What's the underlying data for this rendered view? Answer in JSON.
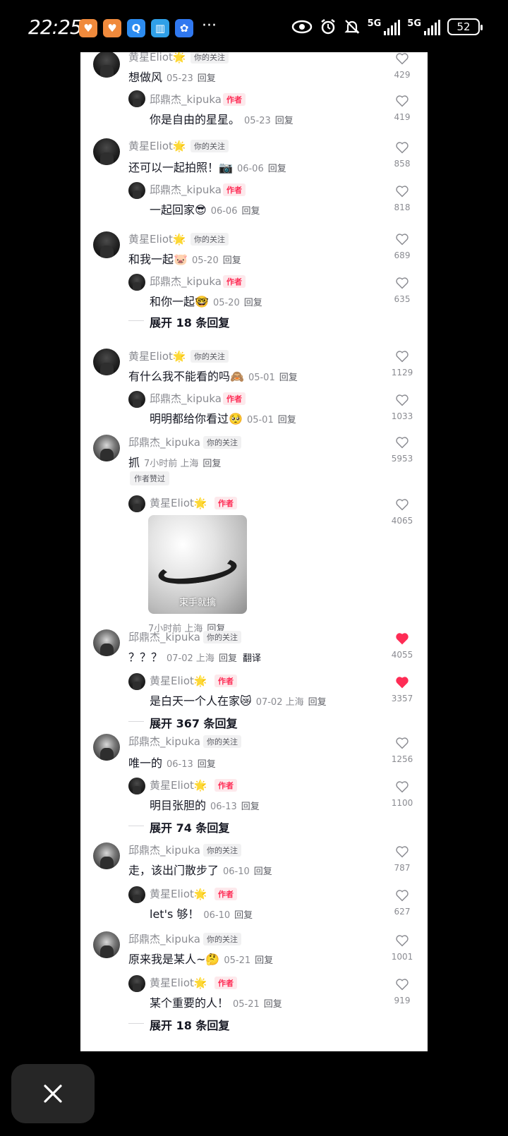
{
  "status_bar": {
    "time": "22:25",
    "network_1": "5G",
    "network_2": "5G",
    "battery": "52"
  },
  "comments": [
    {
      "user": "黄星Eliot🌟",
      "tag": "你的关注",
      "text": "想做风",
      "date": "05-23",
      "reply": "回复",
      "likes": "429",
      "sub": {
        "user": "邱鼎杰_kipuka",
        "tag": "作者",
        "text": "你是自由的星星。",
        "date": "05-23",
        "reply": "回复",
        "likes": "419"
      }
    },
    {
      "user": "黄星Eliot🌟",
      "tag": "你的关注",
      "text": "还可以一起拍照！📷",
      "date": "06-06",
      "reply": "回复",
      "likes": "858",
      "sub": {
        "user": "邱鼎杰_kipuka",
        "tag": "作者",
        "text": "一起回家😎",
        "date": "06-06",
        "reply": "回复",
        "likes": "818"
      }
    },
    {
      "user": "黄星Eliot🌟",
      "tag": "你的关注",
      "text": "和我一起🐷",
      "date": "05-20",
      "reply": "回复",
      "likes": "689",
      "sub": {
        "user": "邱鼎杰_kipuka",
        "tag": "作者",
        "text": "和你一起🤓",
        "date": "05-20",
        "reply": "回复",
        "likes": "635"
      },
      "expand": "展开 18 条回复"
    },
    {
      "user": "黄星Eliot🌟",
      "tag": "你的关注",
      "text": "有什么我不能看的吗🙈",
      "date": "05-01",
      "reply": "回复",
      "likes": "1129",
      "sub": {
        "user": "邱鼎杰_kipuka",
        "tag": "作者",
        "text": "明明都给你看过🥺",
        "date": "05-01",
        "reply": "回复",
        "likes": "1033"
      }
    },
    {
      "user": "邱鼎杰_kipuka",
      "tag": "你的关注",
      "text": "抓",
      "date": "7小时前 上海",
      "reply": "回复",
      "likes": "5953",
      "liked_by": "作者赞过",
      "sub": {
        "user": "黄星Eliot🌟",
        "tag": "作者",
        "sticker_caption": "束手就擒",
        "date": "7小时前 上海",
        "reply": "回复",
        "likes": "4065"
      }
    },
    {
      "user": "邱鼎杰_kipuka",
      "tag": "你的关注",
      "text": "？？？",
      "date": "07-02 上海",
      "reply": "回复",
      "translate": "翻译",
      "likes": "4055",
      "sub": {
        "user": "黄星Eliot🌟",
        "tag": "作者",
        "text": "是白天一个人在家😿",
        "date": "07-02 上海",
        "reply": "回复",
        "likes": "3357"
      },
      "expand": "展开 367 条回复"
    },
    {
      "user": "邱鼎杰_kipuka",
      "tag": "你的关注",
      "text": "唯一的",
      "date": "06-13",
      "reply": "回复",
      "likes": "1256",
      "sub": {
        "user": "黄星Eliot🌟",
        "tag": "作者",
        "text": "明目张胆的",
        "date": "06-13",
        "reply": "回复",
        "likes": "1100"
      },
      "expand": "展开 74 条回复"
    },
    {
      "user": "邱鼎杰_kipuka",
      "tag": "你的关注",
      "text": "走，该出门散步了",
      "date": "06-10",
      "reply": "回复",
      "likes": "787",
      "sub": {
        "user": "黄星Eliot🌟",
        "tag": "作者",
        "text": "let's 够！",
        "date": "06-10",
        "reply": "回复",
        "likes": "627"
      }
    },
    {
      "user": "邱鼎杰_kipuka",
      "tag": "你的关注",
      "text": "原来我是某人~🤔",
      "date": "05-21",
      "reply": "回复",
      "likes": "1001",
      "sub": {
        "user": "黄星Eliot🌟",
        "tag": "作者",
        "text": "某个重要的人！",
        "date": "05-21",
        "reply": "回复",
        "likes": "919"
      },
      "expand": "展开 18 条回复"
    }
  ],
  "colors": {
    "like_active": "#fe2c55",
    "author_tag": "#fe2c55"
  },
  "icons": {
    "close": "close-icon",
    "heart": "heart-icon"
  }
}
